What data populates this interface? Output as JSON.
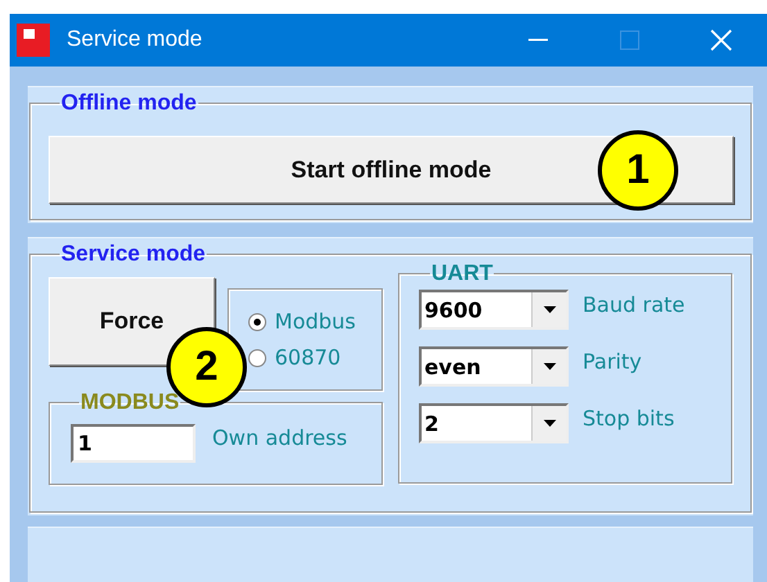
{
  "window": {
    "title": "Service mode"
  },
  "offline_mode": {
    "legend": "Offline mode",
    "button": "Start offline mode"
  },
  "service_mode": {
    "legend": "Service mode",
    "force_button": "Force",
    "protocol": [
      {
        "label": "Modbus",
        "selected": true
      },
      {
        "label": "60870",
        "selected": false
      }
    ],
    "modbus": {
      "legend": "MODBUS",
      "address_value": "1",
      "address_label": "Own address"
    },
    "uart": {
      "legend": "UART",
      "fields": [
        {
          "value": "9600",
          "label": "Baud rate"
        },
        {
          "value": "even",
          "label": "Parity"
        },
        {
          "value": "2",
          "label": "Stop bits"
        }
      ]
    }
  },
  "callouts": [
    {
      "number": "1"
    },
    {
      "number": "2"
    }
  ]
}
